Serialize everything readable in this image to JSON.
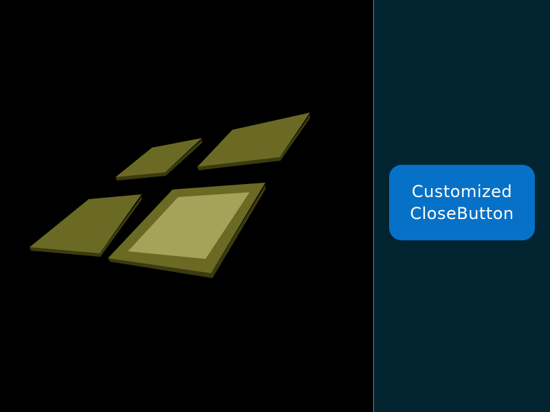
{
  "colors": {
    "viewport_background": "#000000",
    "panel_background": "#022430",
    "divider": "#6f8a95",
    "button_background": "#0771c7",
    "button_text": "#ffffff",
    "tile_top": "#6b6a24",
    "tile_side": "#3c3b10",
    "tile_highlight": "#a5a35a"
  },
  "scene": {
    "tiles": [
      "tile-top-left",
      "tile-top-right",
      "tile-bottom-left",
      "tile-bottom-right-selected"
    ]
  },
  "side_panel": {
    "close_button": {
      "line1": "Customized",
      "line2": "CloseButton"
    }
  }
}
